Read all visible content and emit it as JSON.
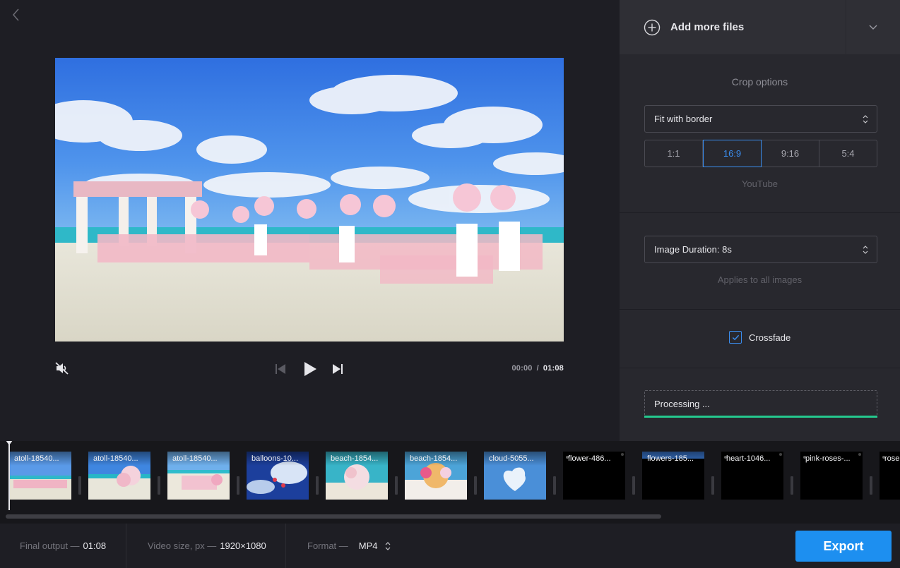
{
  "header": {
    "back_icon": "chevron-left-icon"
  },
  "panel": {
    "add_files_label": "Add more files",
    "crop_title": "Crop options",
    "crop_mode": "Fit with border",
    "ratios": [
      "1:1",
      "16:9",
      "9:16",
      "5:4"
    ],
    "active_ratio": "16:9",
    "ratio_hint": "YouTube",
    "image_duration": "Image Duration: 8s",
    "duration_hint": "Applies to all images",
    "crossfade_label": "Crossfade",
    "crossfade_checked": true,
    "processing_label": "Processing ...",
    "processing_progress": 1.0
  },
  "player": {
    "current_time": "00:00",
    "separator": "/",
    "total_time": "01:08",
    "muted": true
  },
  "timeline": {
    "clips": [
      {
        "name": "atoll-18540...",
        "thumb": "beach-wedding"
      },
      {
        "name": "atoll-18540...",
        "thumb": "beach-flowers"
      },
      {
        "name": "atoll-18540...",
        "thumb": "beach-aisle"
      },
      {
        "name": "balloons-10...",
        "thumb": "balloons"
      },
      {
        "name": "beach-1854...",
        "thumb": "beach-bouquet"
      },
      {
        "name": "beach-1854...",
        "thumb": "flower-table"
      },
      {
        "name": "cloud-5055...",
        "thumb": "heart-cloud"
      },
      {
        "name": "flower-486...",
        "thumb": "black"
      },
      {
        "name": "flowers-185...",
        "thumb": "black-sky"
      },
      {
        "name": "heart-1046...",
        "thumb": "black"
      },
      {
        "name": "pink-roses-...",
        "thumb": "black"
      },
      {
        "name": "rose",
        "thumb": "black"
      }
    ]
  },
  "footer": {
    "final_output_label": "Final output —",
    "final_output_value": "01:08",
    "video_size_label": "Video size, px —",
    "video_size_value": "1920×1080",
    "format_label": "Format —",
    "format_value": "MP4",
    "export_label": "Export"
  },
  "colors": {
    "accent": "#1d8ff0",
    "active_ratio": "#3b8ef0",
    "progress": "#24c98e"
  }
}
